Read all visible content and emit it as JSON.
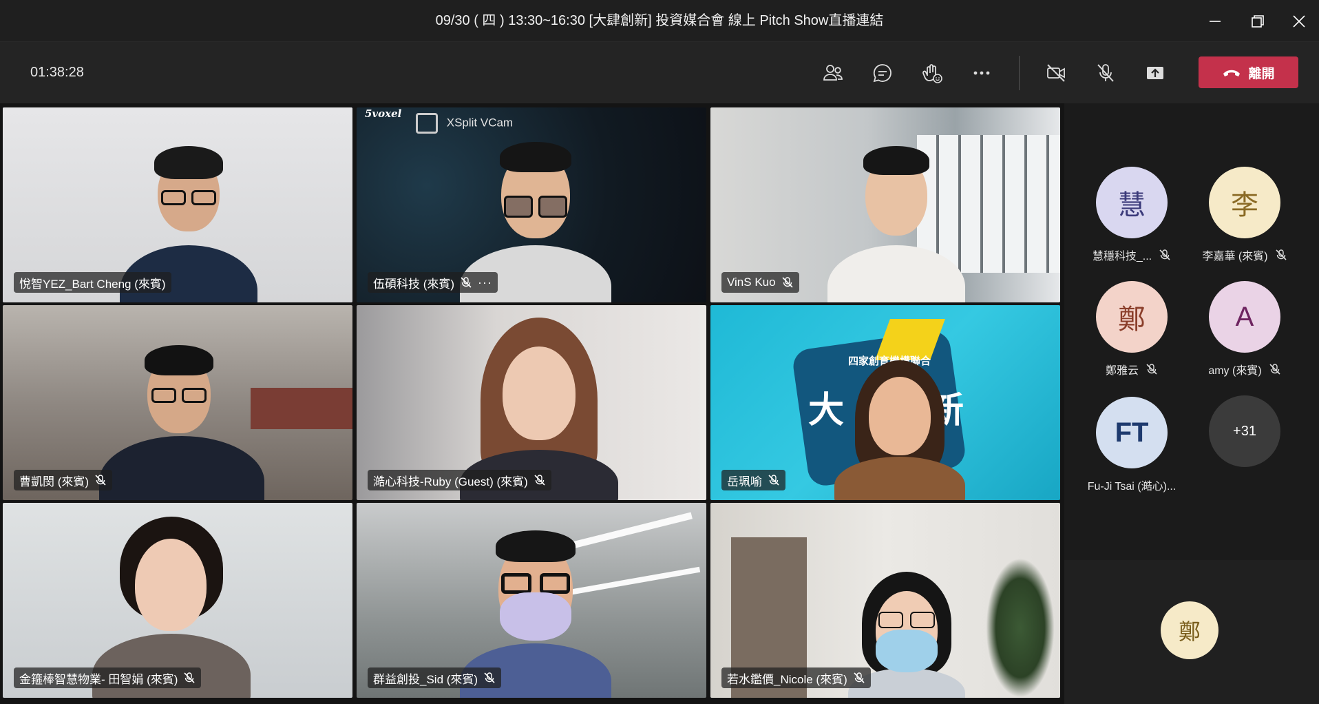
{
  "window": {
    "title": "09/30 ( 四 ) 13:30~16:30 [大肆創新] 投資媒合會 線上 Pitch Show直播連結"
  },
  "toolbar": {
    "timer": "01:38:28",
    "leave_label": "離開",
    "leave_color": "#c4314b",
    "icons": [
      "participants-icon",
      "chat-icon",
      "reactions-icon",
      "more-icon",
      "camera-off-icon",
      "mic-off-icon",
      "share-icon"
    ]
  },
  "tiles": [
    {
      "name": "悅智YEZ_Bart Cheng (來賓)",
      "muted": false,
      "active": true
    },
    {
      "name": "伍碩科技 (來賓)",
      "muted": true,
      "more": true,
      "overlay_brand": "XSplit VCam",
      "overlay_logo": "5voxel"
    },
    {
      "name": "VinS Kuo",
      "muted": true
    },
    {
      "name": "曹凱閔 (來賓)",
      "muted": true
    },
    {
      "name": "澔心科技-Ruby (Guest) (來賓)",
      "muted": true
    },
    {
      "name": "岳珮喻",
      "muted": true,
      "backdrop_text_1": "四家創育機構聯合",
      "backdrop_text_2": "大",
      "backdrop_text_3": "新"
    },
    {
      "name": "金箍棒智慧物業- 田智娟 (來賓)",
      "muted": true
    },
    {
      "name": "群益創投_Sid (來賓)",
      "muted": true
    },
    {
      "name": "若水鑑價_Nicole (來賓)",
      "muted": true
    }
  ],
  "roster": [
    {
      "initials": "慧",
      "name": "慧穩科技_...",
      "bg": "#d9d7f0",
      "fg": "#3b3a7a",
      "muted": true
    },
    {
      "initials": "李",
      "name": "李嘉華 (來賓)",
      "bg": "#f6eac8",
      "fg": "#8a6a24",
      "muted": true
    },
    {
      "initials": "鄭",
      "name": "鄭雅云",
      "bg": "#f3d3c9",
      "fg": "#8a3e2a",
      "muted": true
    },
    {
      "initials": "A",
      "name": "amy (來賓)",
      "bg": "#ead3e6",
      "fg": "#6e2460",
      "muted": true
    },
    {
      "initials": "FT",
      "name": "Fu-Ji Tsai (澔心)...",
      "bg": "#d4dff0",
      "fg": "#1e3a6e",
      "muted": false
    },
    {
      "initials": "+31",
      "name": "",
      "bg": "#3b3b3b",
      "fg": "#ffffff",
      "muted": false
    }
  ],
  "pinned": {
    "initials": "鄭"
  }
}
